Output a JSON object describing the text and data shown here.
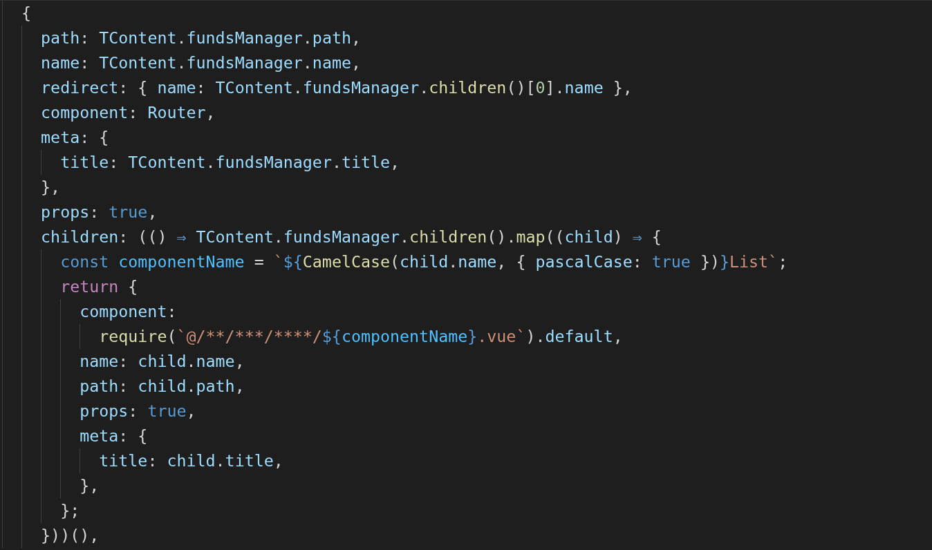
{
  "editor": {
    "lines": [
      {
        "tokens": [
          {
            "text": "  {",
            "kind": "punct"
          }
        ]
      },
      {
        "tokens": [
          {
            "text": "    path",
            "kind": "var"
          },
          {
            "text": ": ",
            "kind": "punct"
          },
          {
            "text": "TContent",
            "kind": "var"
          },
          {
            "text": ".",
            "kind": "punct"
          },
          {
            "text": "fundsManager",
            "kind": "var"
          },
          {
            "text": ".",
            "kind": "punct"
          },
          {
            "text": "path",
            "kind": "var"
          },
          {
            "text": ",",
            "kind": "punct"
          }
        ]
      },
      {
        "tokens": [
          {
            "text": "    name",
            "kind": "var"
          },
          {
            "text": ": ",
            "kind": "punct"
          },
          {
            "text": "TContent",
            "kind": "var"
          },
          {
            "text": ".",
            "kind": "punct"
          },
          {
            "text": "fundsManager",
            "kind": "var"
          },
          {
            "text": ".",
            "kind": "punct"
          },
          {
            "text": "name",
            "kind": "var"
          },
          {
            "text": ",",
            "kind": "punct"
          }
        ]
      },
      {
        "tokens": [
          {
            "text": "    redirect",
            "kind": "var"
          },
          {
            "text": ": { ",
            "kind": "punct"
          },
          {
            "text": "name",
            "kind": "var"
          },
          {
            "text": ": ",
            "kind": "punct"
          },
          {
            "text": "TContent",
            "kind": "var"
          },
          {
            "text": ".",
            "kind": "punct"
          },
          {
            "text": "fundsManager",
            "kind": "var"
          },
          {
            "text": ".",
            "kind": "punct"
          },
          {
            "text": "children",
            "kind": "func"
          },
          {
            "text": "()[",
            "kind": "punct"
          },
          {
            "text": "0",
            "kind": "number"
          },
          {
            "text": "].",
            "kind": "punct"
          },
          {
            "text": "name",
            "kind": "var"
          },
          {
            "text": " },",
            "kind": "punct"
          }
        ]
      },
      {
        "tokens": [
          {
            "text": "    component",
            "kind": "var"
          },
          {
            "text": ": ",
            "kind": "punct"
          },
          {
            "text": "Router",
            "kind": "var"
          },
          {
            "text": ",",
            "kind": "punct"
          }
        ]
      },
      {
        "tokens": [
          {
            "text": "    meta",
            "kind": "var"
          },
          {
            "text": ": {",
            "kind": "punct"
          }
        ]
      },
      {
        "tokens": [
          {
            "text": "      title",
            "kind": "var"
          },
          {
            "text": ": ",
            "kind": "punct"
          },
          {
            "text": "TContent",
            "kind": "var"
          },
          {
            "text": ".",
            "kind": "punct"
          },
          {
            "text": "fundsManager",
            "kind": "var"
          },
          {
            "text": ".",
            "kind": "punct"
          },
          {
            "text": "title",
            "kind": "var"
          },
          {
            "text": ",",
            "kind": "punct"
          }
        ]
      },
      {
        "tokens": [
          {
            "text": "    },",
            "kind": "punct"
          }
        ]
      },
      {
        "tokens": [
          {
            "text": "    props",
            "kind": "var"
          },
          {
            "text": ": ",
            "kind": "punct"
          },
          {
            "text": "true",
            "kind": "keyword"
          },
          {
            "text": ",",
            "kind": "punct"
          }
        ]
      },
      {
        "tokens": [
          {
            "text": "    children",
            "kind": "var"
          },
          {
            "text": ": (() ",
            "kind": "punct"
          },
          {
            "text": "⇒",
            "kind": "keyword"
          },
          {
            "text": " TContent",
            "kind": "var"
          },
          {
            "text": ".",
            "kind": "punct"
          },
          {
            "text": "fundsManager",
            "kind": "var"
          },
          {
            "text": ".",
            "kind": "punct"
          },
          {
            "text": "children",
            "kind": "func"
          },
          {
            "text": "().",
            "kind": "punct"
          },
          {
            "text": "map",
            "kind": "func"
          },
          {
            "text": "((",
            "kind": "punct"
          },
          {
            "text": "child",
            "kind": "var"
          },
          {
            "text": ") ",
            "kind": "punct"
          },
          {
            "text": "⇒",
            "kind": "keyword"
          },
          {
            "text": " {",
            "kind": "punct"
          }
        ]
      },
      {
        "tokens": [
          {
            "text": "      const ",
            "kind": "keyword"
          },
          {
            "text": "componentName",
            "kind": "const"
          },
          {
            "text": " = ",
            "kind": "punct"
          },
          {
            "text": "`",
            "kind": "string"
          },
          {
            "text": "${",
            "kind": "keyword"
          },
          {
            "text": "CamelCase",
            "kind": "func"
          },
          {
            "text": "(",
            "kind": "punct"
          },
          {
            "text": "child",
            "kind": "var"
          },
          {
            "text": ".",
            "kind": "punct"
          },
          {
            "text": "name",
            "kind": "var"
          },
          {
            "text": ", { ",
            "kind": "punct"
          },
          {
            "text": "pascalCase",
            "kind": "var"
          },
          {
            "text": ": ",
            "kind": "punct"
          },
          {
            "text": "true",
            "kind": "keyword"
          },
          {
            "text": " })",
            "kind": "punct"
          },
          {
            "text": "}",
            "kind": "keyword"
          },
          {
            "text": "List`",
            "kind": "string"
          },
          {
            "text": ";",
            "kind": "punct"
          }
        ]
      },
      {
        "tokens": [
          {
            "text": "      return",
            "kind": "control"
          },
          {
            "text": " {",
            "kind": "punct"
          }
        ]
      },
      {
        "tokens": [
          {
            "text": "        component",
            "kind": "var"
          },
          {
            "text": ":",
            "kind": "punct"
          }
        ]
      },
      {
        "tokens": [
          {
            "text": "          require",
            "kind": "func"
          },
          {
            "text": "(",
            "kind": "punct"
          },
          {
            "text": "`@/**/***/****/",
            "kind": "string"
          },
          {
            "text": "${",
            "kind": "keyword"
          },
          {
            "text": "componentName",
            "kind": "const"
          },
          {
            "text": "}",
            "kind": "keyword"
          },
          {
            "text": ".vue`",
            "kind": "string"
          },
          {
            "text": ").",
            "kind": "punct"
          },
          {
            "text": "default",
            "kind": "var"
          },
          {
            "text": ",",
            "kind": "punct"
          }
        ]
      },
      {
        "tokens": [
          {
            "text": "        name",
            "kind": "var"
          },
          {
            "text": ": ",
            "kind": "punct"
          },
          {
            "text": "child",
            "kind": "var"
          },
          {
            "text": ".",
            "kind": "punct"
          },
          {
            "text": "name",
            "kind": "var"
          },
          {
            "text": ",",
            "kind": "punct"
          }
        ]
      },
      {
        "tokens": [
          {
            "text": "        path",
            "kind": "var"
          },
          {
            "text": ": ",
            "kind": "punct"
          },
          {
            "text": "child",
            "kind": "var"
          },
          {
            "text": ".",
            "kind": "punct"
          },
          {
            "text": "path",
            "kind": "var"
          },
          {
            "text": ",",
            "kind": "punct"
          }
        ]
      },
      {
        "tokens": [
          {
            "text": "        props",
            "kind": "var"
          },
          {
            "text": ": ",
            "kind": "punct"
          },
          {
            "text": "true",
            "kind": "keyword"
          },
          {
            "text": ",",
            "kind": "punct"
          }
        ]
      },
      {
        "tokens": [
          {
            "text": "        meta",
            "kind": "var"
          },
          {
            "text": ": {",
            "kind": "punct"
          }
        ]
      },
      {
        "tokens": [
          {
            "text": "          title",
            "kind": "var"
          },
          {
            "text": ": ",
            "kind": "punct"
          },
          {
            "text": "child",
            "kind": "var"
          },
          {
            "text": ".",
            "kind": "punct"
          },
          {
            "text": "title",
            "kind": "var"
          },
          {
            "text": ",",
            "kind": "punct"
          }
        ]
      },
      {
        "tokens": [
          {
            "text": "        },",
            "kind": "punct"
          }
        ]
      },
      {
        "tokens": [
          {
            "text": "      };",
            "kind": "punct"
          }
        ]
      },
      {
        "tokens": [
          {
            "text": "    }))(),",
            "kind": "punct"
          }
        ]
      }
    ]
  }
}
